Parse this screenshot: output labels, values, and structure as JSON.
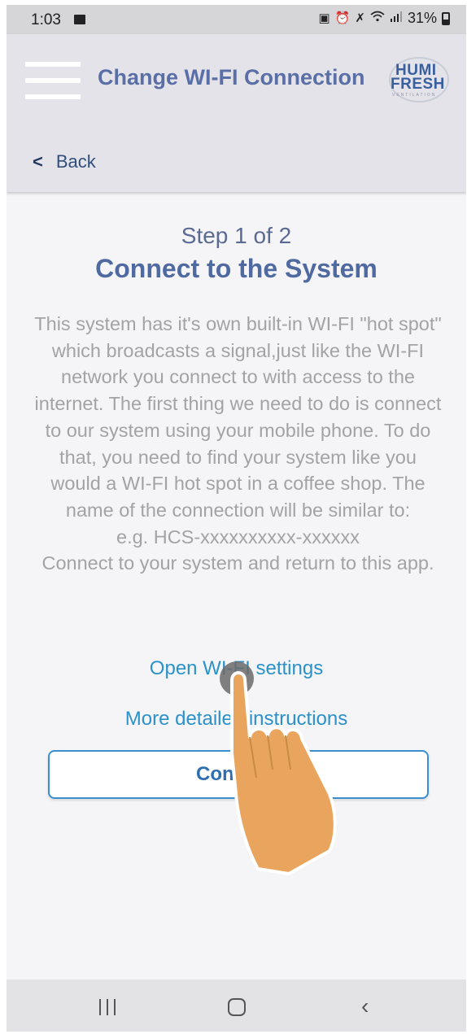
{
  "status_bar": {
    "time": "1:03",
    "battery": "31%",
    "icons": [
      "image-icon",
      "lock-icon",
      "alarm-icon",
      "mute-icon",
      "wifi-icon",
      "signal-icon",
      "battery-icon"
    ]
  },
  "header": {
    "title": "Change WI-FI Connection",
    "logo": {
      "line1": "HUMI",
      "line2": "FRESH",
      "tagline": "VENTILATION"
    },
    "back_label": "Back",
    "colors": {
      "title": "#5a6fa6",
      "background": "#e4e3ea"
    }
  },
  "main": {
    "step_label": "Step 1 of 2",
    "title": "Connect to the System",
    "description_lines": [
      "This system has it's own built-in WI-FI \"hot spot\" which broadcasts a signal,just like the WI-FI network you connect to with access to the internet. The first thing we need to do is connect to our system using your mobile phone. To do that, you need to find your system like you would a WI-FI hot spot in a coffee shop. The name of the connection will be similar to:",
      "e.g. HCS-xxxxxxxxxx-xxxxxx",
      "Connect to your system and return to this app."
    ],
    "open_wifi_link": "Open WI-FI settings",
    "more_details_link": "More detailed instructions",
    "continue_button": "Continue",
    "colors": {
      "link": "#2b91c9",
      "button_border": "#3a8fd0"
    }
  },
  "nav_bar": {
    "icons": [
      "recent-apps-icon",
      "home-icon",
      "back-icon"
    ]
  },
  "overlay": {
    "gesture": "tap",
    "hand_color": "#e9a55e"
  }
}
